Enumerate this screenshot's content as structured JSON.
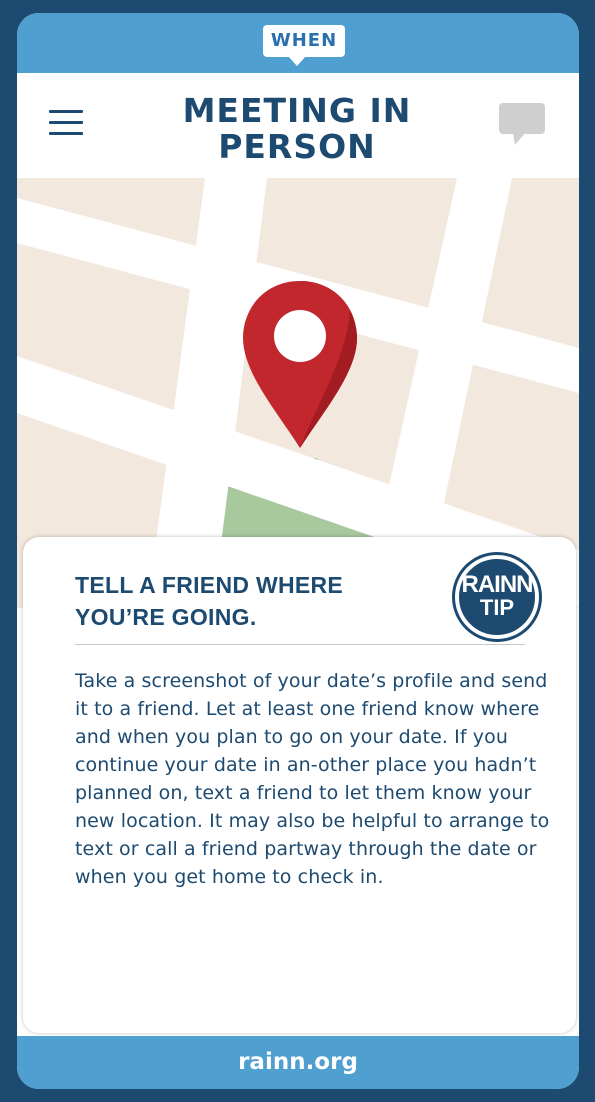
{
  "app": {
    "logo_text": "WHEN",
    "title_line1": "MEETING IN",
    "title_line2": "PERSON"
  },
  "header": {
    "menu_icon": "hamburger-menu-icon",
    "chat_icon": "chat-bubble-icon"
  },
  "map": {
    "pin_icon": "location-pin-icon",
    "colors": {
      "land": "#f3e8dd",
      "road": "#ffffff",
      "park": "#a8c99e",
      "pin": "#c1272d"
    }
  },
  "tip": {
    "heading_line1": "TELL A FRIEND WHERE",
    "heading_line2": "YOU’RE GOING.",
    "badge_line1": "RAINN",
    "badge_line2": "TIP",
    "body": "Take a screenshot of your date’s profile and send it to a friend. Let at least one friend know where and when you plan to go on your date. If you continue your date in an-other place you hadn’t planned on, text a friend to let them know your new location. It may also be helpful to arrange to text or call a friend partway through the date or when you get home to check in."
  },
  "footer": {
    "link_text": "rainn.org"
  },
  "colors": {
    "brand_blue": "#4f9fd0",
    "navy": "#1d4a70"
  }
}
